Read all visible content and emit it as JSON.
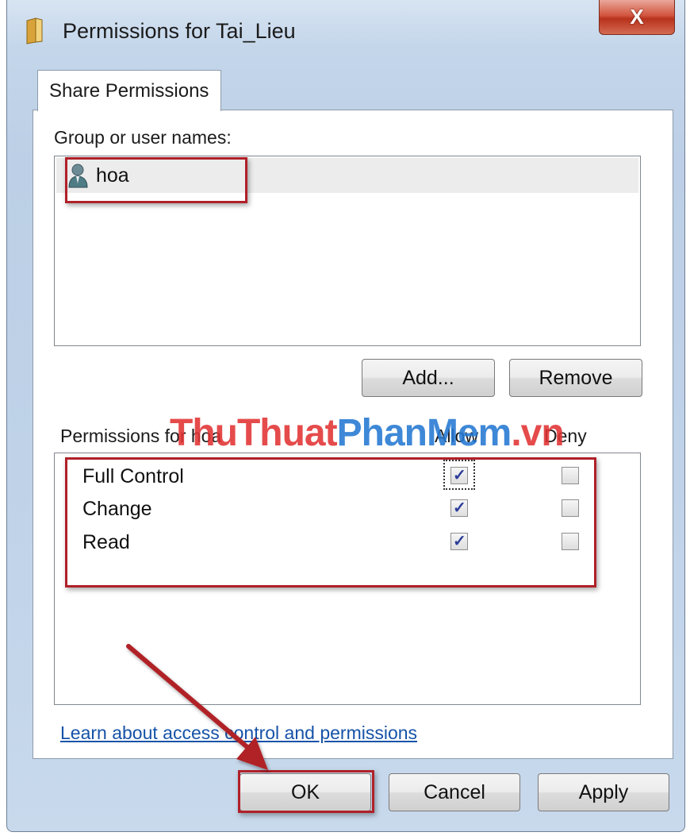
{
  "window": {
    "title": "Permissions for Tai_Lieu",
    "close_label": "X"
  },
  "tabs": [
    {
      "label": "Share Permissions",
      "active": true
    }
  ],
  "users": {
    "label": "Group or user names:",
    "items": [
      {
        "name": "hoa",
        "icon": "user-icon",
        "selected": true
      }
    ]
  },
  "user_buttons": {
    "add": "Add...",
    "remove": "Remove"
  },
  "permissions": {
    "header": "Permissions for hoa",
    "allow_label": "Allow",
    "deny_label": "Deny",
    "rows": [
      {
        "name": "Full Control",
        "allow": true,
        "deny": false
      },
      {
        "name": "Change",
        "allow": true,
        "deny": false
      },
      {
        "name": "Read",
        "allow": true,
        "deny": false
      }
    ]
  },
  "watermark": {
    "part1": "ThuThuat",
    "part2": "PhanMem",
    "part3": ".vn"
  },
  "learn_link": "Learn about access control and permissions",
  "footer_buttons": {
    "ok": "OK",
    "cancel": "Cancel",
    "apply": "Apply"
  },
  "colors": {
    "highlight": "#b02028",
    "link": "#1553a8",
    "checkmark": "#2c3d9a"
  }
}
